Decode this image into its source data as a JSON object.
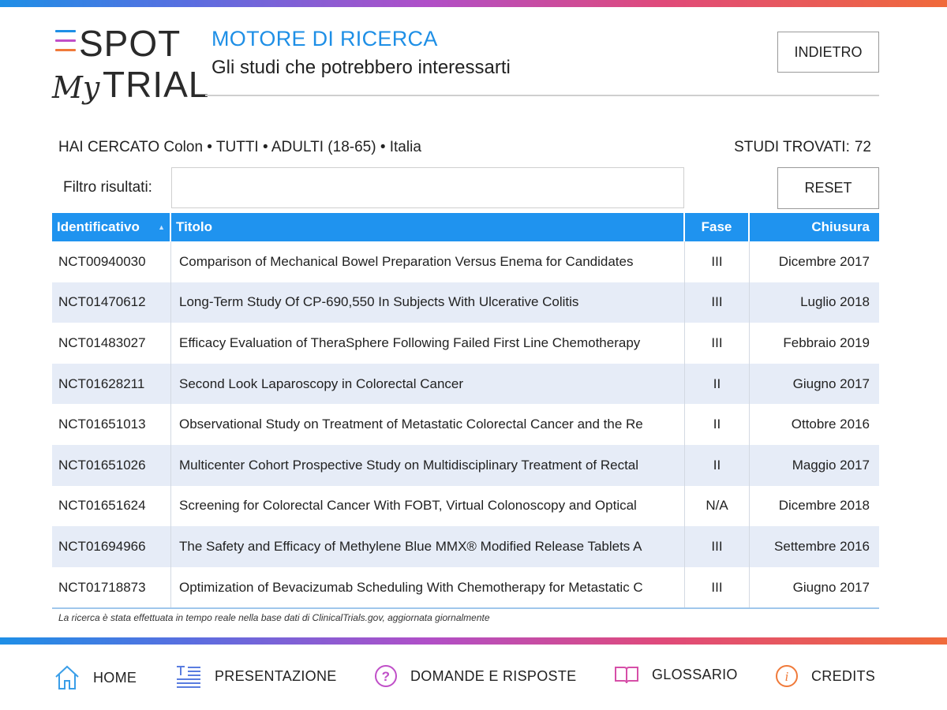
{
  "brand": {
    "logo_top": "SPOT",
    "logo_my": "My",
    "logo_bottom": "TRIAL"
  },
  "header": {
    "title": "MOTORE DI RICERCA",
    "subtitle": "Gli studi che potrebbero interessarti",
    "back_label": "INDIETRO"
  },
  "search": {
    "summary": "HAI CERCATO Colon •  TUTTI • ADULTI (18-65) • Italia",
    "count_label": "STUDI TROVATI:",
    "count_value": "72",
    "filter_label": "Filtro risultati:",
    "filter_value": "",
    "reset_label": "RESET"
  },
  "table": {
    "columns": [
      "Identificativo",
      "Titolo",
      "Fase",
      "Chiusura"
    ],
    "rows": [
      {
        "id": "NCT00940030",
        "title": "Comparison of Mechanical Bowel Preparation Versus Enema for Candidates",
        "phase": "III",
        "close": "Dicembre 2017"
      },
      {
        "id": "NCT01470612",
        "title": "Long-Term Study Of CP-690,550 In Subjects With Ulcerative Colitis",
        "phase": "III",
        "close": "Luglio 2018"
      },
      {
        "id": "NCT01483027",
        "title": "Efficacy Evaluation of TheraSphere Following Failed First Line Chemotherapy",
        "phase": "III",
        "close": "Febbraio 2019"
      },
      {
        "id": "NCT01628211",
        "title": "Second Look Laparoscopy in Colorectal Cancer",
        "phase": "II",
        "close": "Giugno 2017"
      },
      {
        "id": "NCT01651013",
        "title": "Observational Study on Treatment of Metastatic Colorectal Cancer and the Re",
        "phase": "II",
        "close": "Ottobre 2016"
      },
      {
        "id": "NCT01651026",
        "title": "Multicenter Cohort Prospective Study on Multidisciplinary Treatment of Rectal",
        "phase": "II",
        "close": "Maggio 2017"
      },
      {
        "id": "NCT01651624",
        "title": "Screening for Colorectal Cancer With FOBT, Virtual Colonoscopy and Optical",
        "phase": "N/A",
        "close": "Dicembre 2018"
      },
      {
        "id": "NCT01694966",
        "title": "The Safety and Efficacy of Methylene Blue MMX® Modified Release Tablets A",
        "phase": "III",
        "close": "Settembre 2016"
      },
      {
        "id": "NCT01718873",
        "title": "Optimization of Bevacizumab Scheduling With Chemotherapy for Metastatic C",
        "phase": "III",
        "close": "Giugno 2017"
      }
    ]
  },
  "footer_note": "La ricerca è stata effettuata in tempo reale nella base dati di ClinicalTrials.gov, aggiornata giornalmente",
  "nav": [
    {
      "label": "HOME",
      "icon": "home-icon"
    },
    {
      "label": "PRESENTAZIONE",
      "icon": "presentation-icon"
    },
    {
      "label": "DOMANDE E RISPOSTE",
      "icon": "question-icon"
    },
    {
      "label": "GLOSSARIO",
      "icon": "book-icon"
    },
    {
      "label": "CREDITS",
      "icon": "info-icon"
    }
  ],
  "colors": {
    "accent": "#1f93ef",
    "row_alt": "#e6ecf7",
    "home_icon": "#3a9ee8",
    "presentation_icon": "#5a7de0",
    "question_icon": "#c04fc8",
    "book_icon": "#d64fa8",
    "info_icon": "#f07a3a"
  }
}
